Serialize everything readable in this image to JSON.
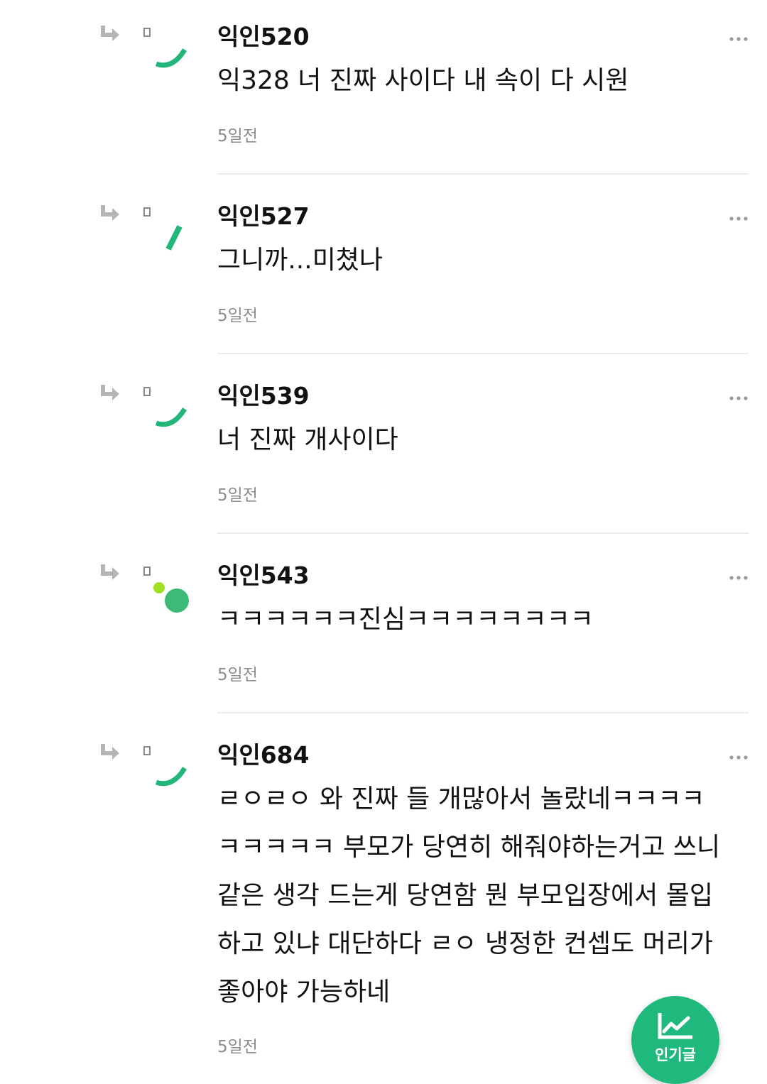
{
  "colors": {
    "accent": "#1fb97d",
    "avatar_green": "#22b67a",
    "avatar_lime": "#9fe024",
    "meta_text": "#8c8c8c",
    "divider": "#ececec"
  },
  "comments": [
    {
      "author": "익인520",
      "text": [
        "익328 너 진짜 사이다 내 속이 다 시원"
      ],
      "time": "5일전",
      "avatar_icon": "arc-avatar-icon"
    },
    {
      "author": "익인527",
      "text": [
        "그니까...미쳤나"
      ],
      "time": "5일전",
      "avatar_icon": "slash-avatar-icon"
    },
    {
      "author": "익인539",
      "text": [
        "너 진짜 개사이다"
      ],
      "time": "5일전",
      "avatar_icon": "arc-avatar-icon"
    },
    {
      "author": "익인543",
      "text": [
        "ㅋㅋㅋㅋㅋㅋ진심ㅋㅋㅋㅋㅋㅋㅋㅋ"
      ],
      "time": "5일전",
      "avatar_icon": "dots-avatar-icon"
    },
    {
      "author": "익인684",
      "text": [
        "ㄹㅇㄹㅇ 와 진짜 들 개많아서 놀랐네ㅋㅋㅋㅋ",
        "ㅋㅋㅋㅋㅋ 부모가 당연히 해줘야하는거고 쓰니",
        "같은 생각 드는게 당연함 뭔 부모입장에서 몰입",
        "하고 있냐 대단하다 ㄹㅇ 냉정한 컨셉도 머리가",
        "좋아야 가능하네"
      ],
      "time": "5일전",
      "avatar_icon": "arc-avatar-icon"
    }
  ],
  "fab": {
    "label": "인기글",
    "icon": "trending-chart-icon"
  }
}
